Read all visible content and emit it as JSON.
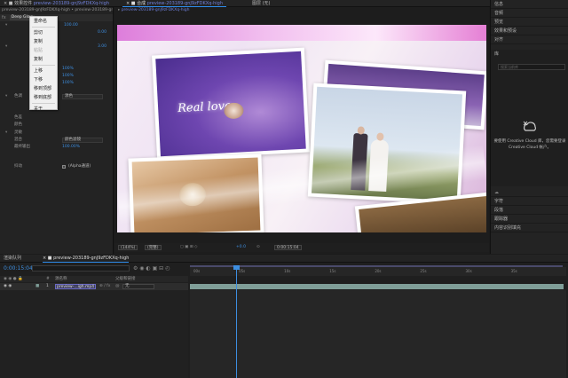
{
  "topbar": {
    "tabs": [
      {
        "label": "× ■ 效果控件",
        "accent": "preview-203189-gnJ9zFDKXq-high",
        "active": false
      },
      {
        "label": "× ■ 合成",
        "accent": "preview-203189-gnJ9zFDKXq-high",
        "active": true
      },
      {
        "label": "图层 (无)",
        "accent": "",
        "active": false
      }
    ]
  },
  "effect_controls": {
    "subtitle": "preview-203189-gnJ9zFDKXq-high • preview-203189-gnJ9zFDKXq-high",
    "effect_name": "Deep Glow",
    "props": [
      {
        "tri": "▾",
        "label": "",
        "val": "100.00",
        "val2": ""
      },
      {
        "tri": "",
        "label": "",
        "val": "",
        "val2": "0.00"
      },
      {
        "tri": "▾",
        "label": "",
        "val": "",
        "val2": "3.00"
      },
      {
        "tri": "",
        "label": "",
        "val": "",
        "val2": ""
      },
      {
        "tri": "",
        "label": "",
        "val": "100%",
        "val2": ""
      },
      {
        "tri": "",
        "label": "",
        "val": "100%",
        "val2": ""
      },
      {
        "tri": "",
        "label": "",
        "val": "100%",
        "val2": ""
      },
      {
        "tri": "▾",
        "label": "色调",
        "val": "",
        "val2": ""
      },
      {
        "tri": "",
        "label": "",
        "val": "",
        "val2": ""
      },
      {
        "tri": "",
        "label": "",
        "val": "",
        "val2": ""
      },
      {
        "tri": "",
        "label": "色差",
        "val": "",
        "val2": ""
      },
      {
        "tri": "",
        "label": "颜色",
        "val": "",
        "val2": ""
      },
      {
        "tri": "▾",
        "label": "灵敏",
        "val": "",
        "val2": ""
      },
      {
        "tri": "",
        "label": "混合",
        "val": "",
        "val2": ""
      },
      {
        "tri": "",
        "label": "最终输出",
        "val": "100.00%",
        "val2": ""
      },
      {
        "tri": "",
        "label": "",
        "val": "",
        "val2": ""
      },
      {
        "tri": "",
        "label": "抖动",
        "val": "",
        "val2": ""
      }
    ],
    "dropdown_1": "源色",
    "dropdown_2": "颜色滤镜",
    "checkbox_label": "(Alpha通道)"
  },
  "context_menu": {
    "items": [
      {
        "label": "重命名",
        "disabled": false
      },
      {
        "label": "剪切",
        "disabled": false
      },
      {
        "label": "复制",
        "disabled": false
      },
      {
        "label": "粘贴",
        "disabled": true
      },
      {
        "label": "复制",
        "disabled": false
      },
      {
        "label": "上移",
        "disabled": false
      },
      {
        "label": "下移",
        "disabled": false
      },
      {
        "label": "移到顶部",
        "disabled": false
      },
      {
        "label": "移到底部",
        "disabled": false
      },
      {
        "label": "关于",
        "disabled": false
      }
    ]
  },
  "viewer": {
    "subtitle": "preview-203189-gnJ9zFDKXq-high",
    "love_text": "Real love...",
    "zoom": "(144%)",
    "quality": "(完整)",
    "exposure": "+0.0",
    "timecode": "0:00:15:04"
  },
  "right_panel": {
    "panels": [
      "信息",
      "音频",
      "预览",
      "效果和预设",
      "对齐"
    ],
    "library_title": "库",
    "library_search_placeholder": "搜索当前库",
    "cc_message": "要使用 Creative Cloud 库，您需要登录 Creative Cloud 帐户。",
    "lower_panels": [
      "字符",
      "段落",
      "跟踪器",
      "内容识别填充"
    ]
  },
  "timeline": {
    "tabs": [
      {
        "label": "渲染队列",
        "active": false
      },
      {
        "label": "× ■ preview-203189-gnJ9zFDKXq-high",
        "active": true
      }
    ],
    "timecode": "0:00:15:04",
    "columns": {
      "source": "源名称",
      "parent": "父级和链接"
    },
    "layer": {
      "number": "1",
      "name": "preview-...igh.mp4",
      "parent": "无"
    },
    "ruler_ticks": [
      "00s",
      "05s",
      "10s",
      "15s",
      "20s",
      "25s",
      "30s",
      "35s"
    ],
    "colors": {
      "playhead": "#3d8ee0",
      "track": "#7f9e98",
      "accent": "#6f7fd8"
    }
  }
}
